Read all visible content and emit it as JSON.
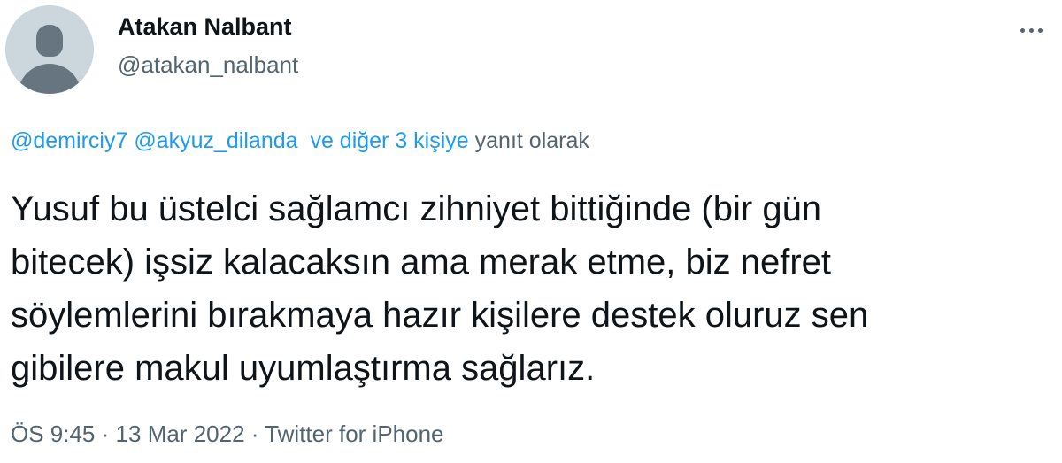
{
  "author": {
    "display_name": "Atakan Nalbant",
    "handle": "@atakan_nalbant"
  },
  "more_menu": {
    "icon": "more-horizontal-icon"
  },
  "reply_context": {
    "mentions": [
      "@demirciy7",
      "@akyuz_dilanda"
    ],
    "others_link": "ve diğer 3 kişiye",
    "suffix": "yanıt olarak"
  },
  "tweet": {
    "lines": [
      "Yusuf bu üstelci sağlamcı zihniyet bittiğinde (bir gün",
      "bitecek) işsiz kalacaksın ama merak etme, biz nefret",
      "söylemlerini bırakmaya hazır kişilere destek oluruz sen",
      "gibilere makul uyumlaştırma sağlarız."
    ]
  },
  "meta": {
    "time": "ÖS 9:45",
    "separator": "·",
    "date": "13 Mar 2022",
    "source": "Twitter for iPhone"
  },
  "colors": {
    "link": "#1d9bf0",
    "secondary_text": "#536471",
    "primary_text": "#0f1419",
    "avatar_bg": "#ccd6dd",
    "avatar_fg": "#66757f"
  }
}
